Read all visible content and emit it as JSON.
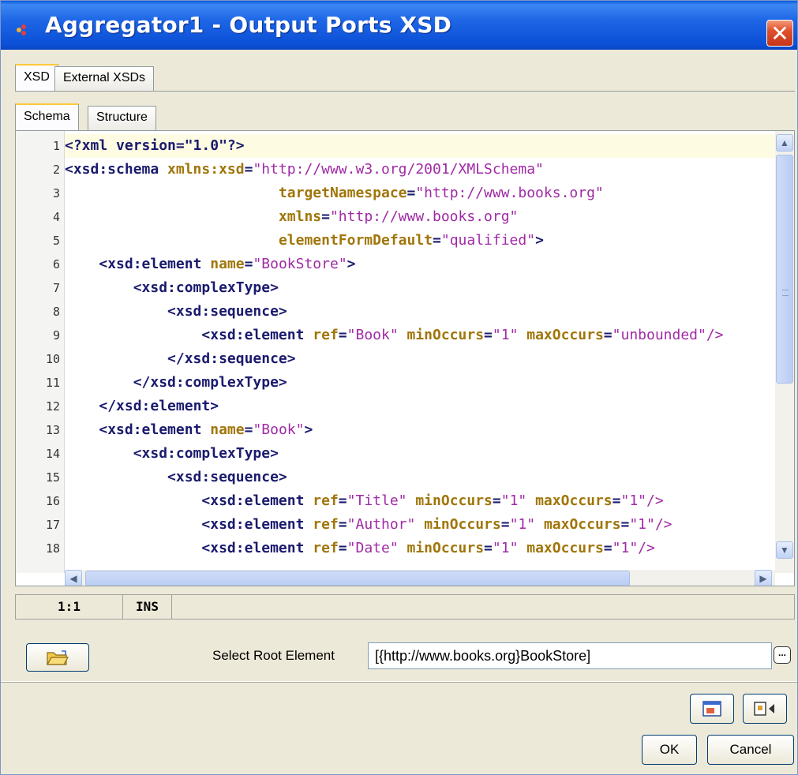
{
  "window": {
    "title": "Aggregator1 - Output Ports XSD",
    "close_label": "✕"
  },
  "outer_tabs": [
    {
      "label": "XSD",
      "active": true
    },
    {
      "label": "External XSDs",
      "active": false
    }
  ],
  "inner_tabs": [
    {
      "label": "Schema",
      "active": true
    },
    {
      "label": "Structure",
      "active": false
    }
  ],
  "editor": {
    "current_line": 1,
    "lines": [
      {
        "n": "1",
        "tokens": [
          [
            "tag",
            "<?xml version=\"1.0\"?>"
          ]
        ]
      },
      {
        "n": "2",
        "tokens": [
          [
            "tag",
            "<xsd:schema "
          ],
          [
            "attr",
            "xmlns:xsd"
          ],
          [
            "tag",
            "="
          ],
          [
            "str",
            "\"http://www.w3.org/2001/XMLSchema\""
          ]
        ]
      },
      {
        "n": "3",
        "tokens": [
          [
            "txt",
            "                         "
          ],
          [
            "attr",
            "targetNamespace"
          ],
          [
            "tag",
            "="
          ],
          [
            "str",
            "\"http://www.books.org\""
          ]
        ]
      },
      {
        "n": "4",
        "tokens": [
          [
            "txt",
            "                         "
          ],
          [
            "attr",
            "xmlns"
          ],
          [
            "tag",
            "="
          ],
          [
            "str",
            "\"http://www.books.org\""
          ]
        ]
      },
      {
        "n": "5",
        "tokens": [
          [
            "txt",
            "                         "
          ],
          [
            "attr",
            "elementFormDefault"
          ],
          [
            "tag",
            "="
          ],
          [
            "str",
            "\"qualified\""
          ],
          [
            "tag",
            ">"
          ]
        ]
      },
      {
        "n": "6",
        "tokens": [
          [
            "txt",
            "    "
          ],
          [
            "tag",
            "<xsd:element "
          ],
          [
            "attr",
            "name"
          ],
          [
            "tag",
            "="
          ],
          [
            "str",
            "\"BookStore\""
          ],
          [
            "tag",
            ">"
          ]
        ]
      },
      {
        "n": "7",
        "tokens": [
          [
            "txt",
            "        "
          ],
          [
            "tag",
            "<xsd:complexType>"
          ]
        ]
      },
      {
        "n": "8",
        "tokens": [
          [
            "txt",
            "            "
          ],
          [
            "tag",
            "<xsd:sequence>"
          ]
        ]
      },
      {
        "n": "9",
        "tokens": [
          [
            "txt",
            "                "
          ],
          [
            "tag",
            "<xsd:element "
          ],
          [
            "attr",
            "ref"
          ],
          [
            "tag",
            "="
          ],
          [
            "str",
            "\"Book\" "
          ],
          [
            "attr",
            "minOccurs"
          ],
          [
            "tag",
            "="
          ],
          [
            "str",
            "\"1\" "
          ],
          [
            "attr",
            "maxOccurs"
          ],
          [
            "tag",
            "="
          ],
          [
            "str",
            "\"unbounded\"/>"
          ]
        ]
      },
      {
        "n": "10",
        "tokens": [
          [
            "txt",
            "            "
          ],
          [
            "tag",
            "</xsd:sequence>"
          ]
        ]
      },
      {
        "n": "11",
        "tokens": [
          [
            "txt",
            "        "
          ],
          [
            "tag",
            "</xsd:complexType>"
          ]
        ]
      },
      {
        "n": "12",
        "tokens": [
          [
            "txt",
            "    "
          ],
          [
            "tag",
            "</xsd:element>"
          ]
        ]
      },
      {
        "n": "13",
        "tokens": [
          [
            "txt",
            "    "
          ],
          [
            "tag",
            "<xsd:element "
          ],
          [
            "attr",
            "name"
          ],
          [
            "tag",
            "="
          ],
          [
            "str",
            "\"Book\""
          ],
          [
            "tag",
            ">"
          ]
        ]
      },
      {
        "n": "14",
        "tokens": [
          [
            "txt",
            "        "
          ],
          [
            "tag",
            "<xsd:complexType>"
          ]
        ]
      },
      {
        "n": "15",
        "tokens": [
          [
            "txt",
            "            "
          ],
          [
            "tag",
            "<xsd:sequence>"
          ]
        ]
      },
      {
        "n": "16",
        "tokens": [
          [
            "txt",
            "                "
          ],
          [
            "tag",
            "<xsd:element "
          ],
          [
            "attr",
            "ref"
          ],
          [
            "tag",
            "="
          ],
          [
            "str",
            "\"Title\" "
          ],
          [
            "attr",
            "minOccurs"
          ],
          [
            "tag",
            "="
          ],
          [
            "str",
            "\"1\" "
          ],
          [
            "attr",
            "maxOccurs"
          ],
          [
            "tag",
            "="
          ],
          [
            "str",
            "\"1\"/>"
          ]
        ]
      },
      {
        "n": "17",
        "tokens": [
          [
            "txt",
            "                "
          ],
          [
            "tag",
            "<xsd:element "
          ],
          [
            "attr",
            "ref"
          ],
          [
            "tag",
            "="
          ],
          [
            "str",
            "\"Author\" "
          ],
          [
            "attr",
            "minOccurs"
          ],
          [
            "tag",
            "="
          ],
          [
            "str",
            "\"1\" "
          ],
          [
            "attr",
            "maxOccurs"
          ],
          [
            "tag",
            "="
          ],
          [
            "str",
            "\"1\"/>"
          ]
        ]
      },
      {
        "n": "18",
        "tokens": [
          [
            "txt",
            "                "
          ],
          [
            "tag",
            "<xsd:element "
          ],
          [
            "attr",
            "ref"
          ],
          [
            "tag",
            "="
          ],
          [
            "str",
            "\"Date\" "
          ],
          [
            "attr",
            "minOccurs"
          ],
          [
            "tag",
            "="
          ],
          [
            "str",
            "\"1\" "
          ],
          [
            "attr",
            "maxOccurs"
          ],
          [
            "tag",
            "="
          ],
          [
            "str",
            "\"1\"/>"
          ]
        ]
      }
    ]
  },
  "status": {
    "position": "1:1",
    "mode": "INS"
  },
  "root": {
    "label": "Select Root Element",
    "value": "[{http://www.books.org}BookStore]",
    "browse_label": "..."
  },
  "buttons": {
    "ok": "OK",
    "cancel": "Cancel"
  },
  "icons": {
    "open": "folder-open-icon",
    "preview": "preview-icon",
    "export": "export-icon"
  },
  "colors": {
    "titlebar": "#0a4fd6",
    "tag": "#1a1a6e",
    "attr": "#a0760a",
    "string": "#a02aa6",
    "current_line": "#fdfbe2"
  }
}
